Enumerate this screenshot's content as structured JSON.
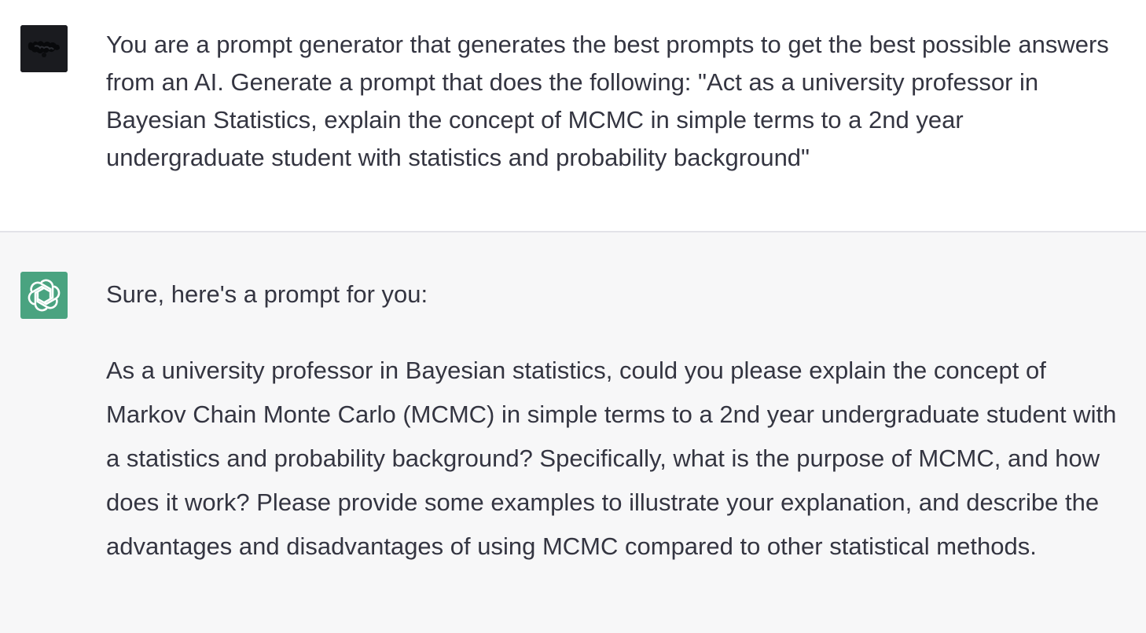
{
  "user_message": {
    "avatar_icon": "user-avatar-icon",
    "text": "You are a prompt generator that generates the best prompts to get the best possible answers from an AI. Generate a prompt that does the following: \"Act as a university professor in Bayesian Statistics, explain the concept of MCMC in simple terms to a 2nd year undergraduate student with statistics and probability background\""
  },
  "assistant_message": {
    "avatar_icon": "openai-logo-icon",
    "intro": "Sure, here's a prompt for you:",
    "generated_prompt": "As a university professor in Bayesian statistics, could you please explain the concept of Markov Chain Monte Carlo (MCMC) in simple terms to a 2nd year undergraduate student with a statistics and probability background? Specifically, what is the purpose of MCMC, and how does it work? Please provide some examples to illustrate your explanation, and describe the advantages and disadvantages of using MCMC compared to other statistical methods."
  },
  "colors": {
    "user_bg": "#ffffff",
    "assistant_bg": "#f7f7f8",
    "assistant_avatar_bg": "#4aa380",
    "text": "#343541"
  }
}
